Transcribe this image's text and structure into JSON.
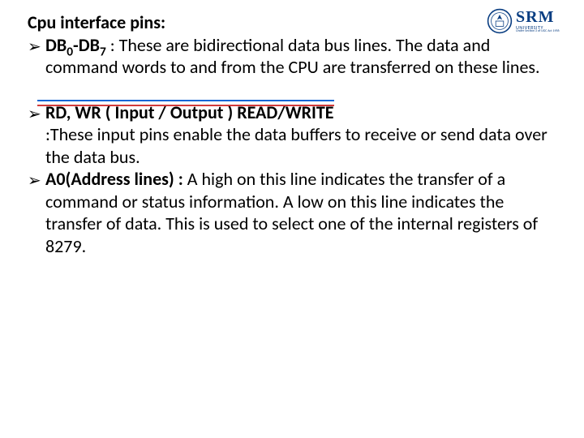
{
  "logo": {
    "srm": "SRM",
    "university": "UNIVERSITY",
    "tagline": "Under Section 3 of UGC Act 1956"
  },
  "heading": "Cpu interface pins:",
  "bullets": {
    "db": {
      "label_prefix": "DB",
      "sub0": "0",
      "dash": "-DB",
      "sub7": "7",
      "colon_intro": " : ",
      "text": "These are bidirectional data bus lines. The data and command words to and from the CPU are transferred on these lines."
    },
    "rdwr": {
      "label": "RD, WR ( Input / Output ) READ/WRITE",
      "text": ":These input pins enable the data buffers to receive or send data over the data bus."
    },
    "a0": {
      "label": "A0(Address lines) : ",
      "text": "A high on this line indicates the transfer of a command or status information. A low on this line indicates the transfer of data. This is used to select one of the internal registers of 8279."
    }
  }
}
